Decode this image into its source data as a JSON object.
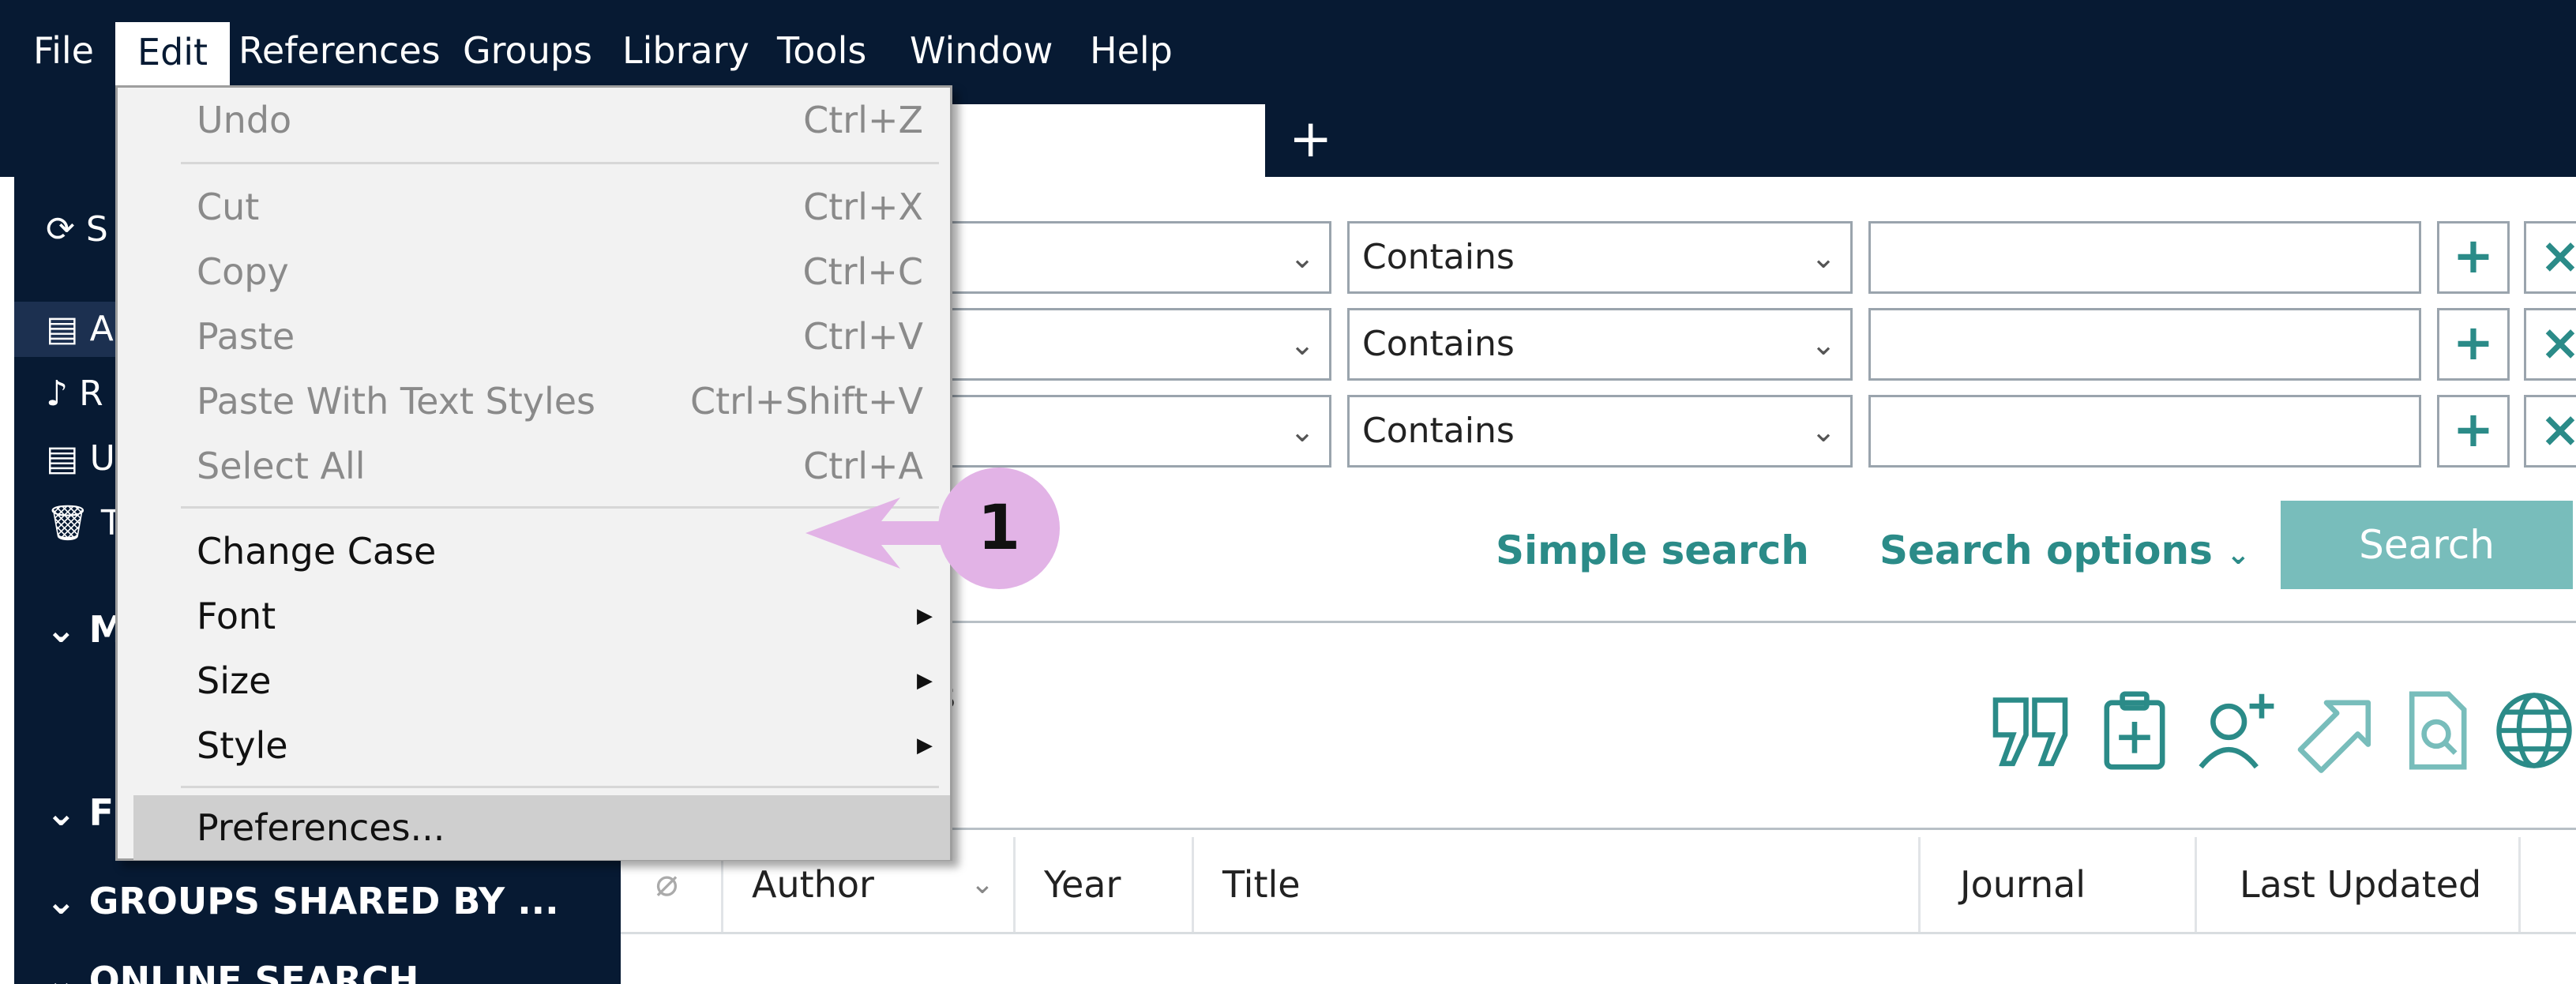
{
  "menubar": {
    "items": [
      {
        "label": "File"
      },
      {
        "label": "Edit"
      },
      {
        "label": "References"
      },
      {
        "label": "Groups"
      },
      {
        "label": "Library"
      },
      {
        "label": "Tools"
      },
      {
        "label": "Window"
      },
      {
        "label": "Help"
      }
    ]
  },
  "tabs": {
    "add_label": "+"
  },
  "sidebar": {
    "rows": [
      {
        "icon": "sync-icon",
        "label": "S"
      },
      {
        "icon": "clipboard-icon",
        "label": "A"
      },
      {
        "icon": "bell-icon",
        "label": "R"
      },
      {
        "icon": "clipboard-icon",
        "label": "U"
      },
      {
        "icon": "trash-icon",
        "label": "T"
      }
    ],
    "sections": [
      {
        "label": "M"
      },
      {
        "label": "F"
      },
      {
        "label": "GROUPS SHARED BY ..."
      },
      {
        "label": "ONLINE SEARCH"
      }
    ]
  },
  "search": {
    "rows": [
      {
        "operator": "Contains",
        "add": "+",
        "remove": "×"
      },
      {
        "operator": "Contains",
        "add": "+",
        "remove": "×"
      },
      {
        "operator": "Contains",
        "add": "+",
        "remove": "×"
      }
    ],
    "simple_search": "Simple search",
    "search_options": "Search options",
    "search_button": "Search"
  },
  "library": {
    "partial_text": "s"
  },
  "table": {
    "columns": [
      "Author",
      "Year",
      "Title",
      "Journal",
      "Last Updated"
    ]
  },
  "edit_menu": {
    "undo": {
      "label": "Undo",
      "shortcut": "Ctrl+Z"
    },
    "cut": {
      "label": "Cut",
      "shortcut": "Ctrl+X"
    },
    "copy": {
      "label": "Copy",
      "shortcut": "Ctrl+C"
    },
    "paste": {
      "label": "Paste",
      "shortcut": "Ctrl+V"
    },
    "paste_styles": {
      "label": "Paste With Text Styles",
      "shortcut": "Ctrl+Shift+V"
    },
    "select_all": {
      "label": "Select All",
      "shortcut": "Ctrl+A"
    },
    "change_case": {
      "label": "Change Case"
    },
    "font": {
      "label": "Font"
    },
    "size": {
      "label": "Size"
    },
    "style": {
      "label": "Style"
    },
    "preferences": {
      "label": "Preferences..."
    }
  },
  "callout": {
    "number": "1"
  },
  "colors": {
    "navy": "#071a33",
    "teal": "#2b8b88",
    "teal_light": "#78bdbb",
    "callout": "#e2b3e6"
  }
}
